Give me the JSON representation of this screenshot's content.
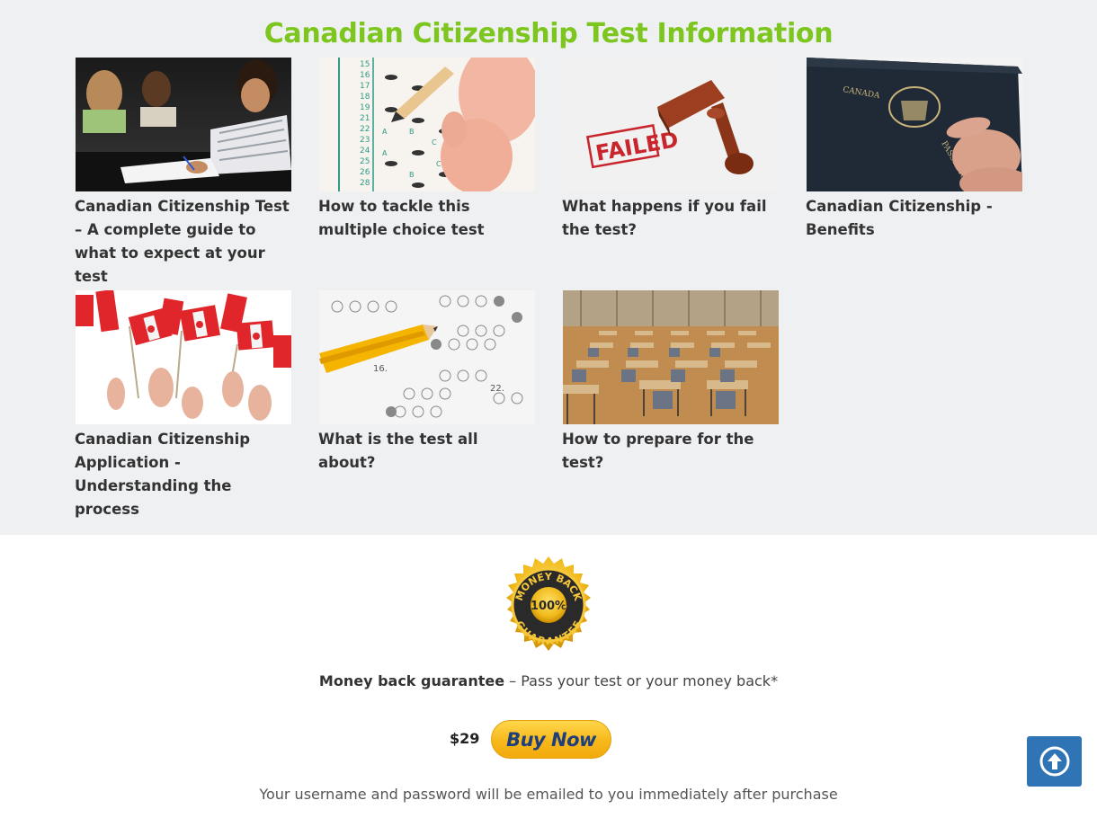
{
  "section": {
    "title": "Canadian Citizenship Test Information"
  },
  "articles": [
    {
      "title": "Canadian Citizenship Test – A complete guide to what to expect at your test",
      "image": "students-writing-exam"
    },
    {
      "title": "How to tackle this multiple choice test",
      "image": "bubble-answer-sheet"
    },
    {
      "title": "What happens if you fail the test?",
      "image": "failed-stamp"
    },
    {
      "title": "Canadian Citizenship - Benefits",
      "image": "canadian-passport"
    },
    {
      "title": "Canadian Citizenship Application - Understanding the process",
      "image": "canadian-flags"
    },
    {
      "title": "What is the test all about?",
      "image": "pencil-answer-sheet"
    },
    {
      "title": "How to prepare for the test?",
      "image": "exam-room"
    }
  ],
  "guarantee": {
    "badge_text_top": "MONEY BACK",
    "badge_text_center": "100%",
    "badge_text_bottom": "GUARANTEE",
    "bold": "Money back guarantee",
    "rest": " – Pass your test or your money back*"
  },
  "purchase": {
    "price": "$29",
    "buy_label": "Buy Now",
    "note": "Your username and password will be emailed to you immediately after purchase"
  },
  "colors": {
    "title_green": "#7dc61f",
    "section_bg": "#eff0f2",
    "scroll_button": "#2f74b5",
    "buy_gold": "#f7b81c",
    "buy_text": "#1f3f7a"
  },
  "icons": {
    "scroll_top": "arrow-up-circle-icon"
  }
}
